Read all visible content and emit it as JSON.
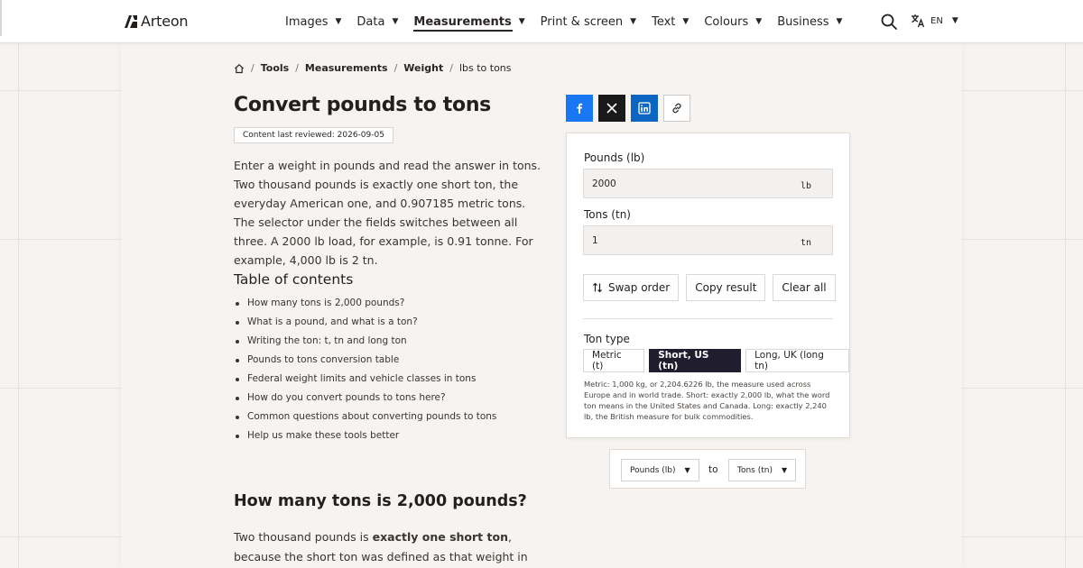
{
  "brand": {
    "name": "Arteon"
  },
  "nav": {
    "items": [
      {
        "label": "Images",
        "active": false
      },
      {
        "label": "Data",
        "active": false
      },
      {
        "label": "Measurements",
        "active": true
      },
      {
        "label": "Print & screen",
        "active": false
      },
      {
        "label": "Text",
        "active": false
      },
      {
        "label": "Colours",
        "active": false
      },
      {
        "label": "Business",
        "active": false
      }
    ],
    "caret": "▼",
    "language": "EN"
  },
  "breadcrumb": {
    "items": [
      "Tools",
      "Measurements",
      "Weight"
    ],
    "current": "lbs to tons",
    "separator": "/"
  },
  "page": {
    "title": "Convert pounds to tons",
    "reviewed": "Content last reviewed: 2026-09-05",
    "intro": "Enter a weight in pounds and read the answer in tons. Two thousand pounds is exactly one short ton, the everyday American one, and 0.907185 metric tons. The selector under the fields switches between all three. A 2000 lb load, for example, is 0.91 tonne. For example, 4,000 lb is 2 tn."
  },
  "toc": {
    "title": "Table of contents",
    "items": [
      "How many tons is 2,000 pounds?",
      "What is a pound, and what is a ton?",
      "Writing the ton: t, tn and long ton",
      "Pounds to tons conversion table",
      "Federal weight limits and vehicle classes in tons",
      "How do you convert pounds to tons here?",
      "Common questions about converting pounds to tons",
      "Help us make these tools better"
    ]
  },
  "section": {
    "heading": "How many tons is 2,000 pounds?",
    "para_pre": "Two thousand pounds is ",
    "para_bold": "exactly one short ton",
    "para_post": ", because the short ton was defined as that weight in the first place."
  },
  "share": {
    "icons": [
      "facebook-icon",
      "x-icon",
      "linkedin-icon",
      "link-icon"
    ]
  },
  "converter": {
    "from_label": "Pounds (lb)",
    "from_value": "2000",
    "from_unit": "lb",
    "to_label": "Tons (tn)",
    "to_value": "1",
    "to_unit": "tn",
    "swap_label": "Swap order",
    "copy_label": "Copy result",
    "clear_label": "Clear all",
    "ton_type_label": "Ton type",
    "ton_types": [
      {
        "label": "Metric (t)",
        "selected": false
      },
      {
        "label": "Short, US (tn)",
        "selected": true
      },
      {
        "label": "Long, UK (long tn)",
        "selected": false
      }
    ],
    "help": "Metric: 1,000 kg, or 2,204.6226 lb, the measure used across Europe and in world trade. Short: exactly 2,000 lb, what the word ton means in the United States and Canada. Long: exactly 2,240 lb, the British measure for bulk commodities."
  },
  "unit_picker": {
    "from": "Pounds (lb)",
    "to_word": "to",
    "to": "Tons (tn)"
  },
  "colors": {
    "facebook": "#1877f2",
    "x": "#1a1a1a",
    "linkedin": "#0a66c2",
    "selected_segment": "#1f1d2e",
    "background": "#f6f3f0"
  }
}
